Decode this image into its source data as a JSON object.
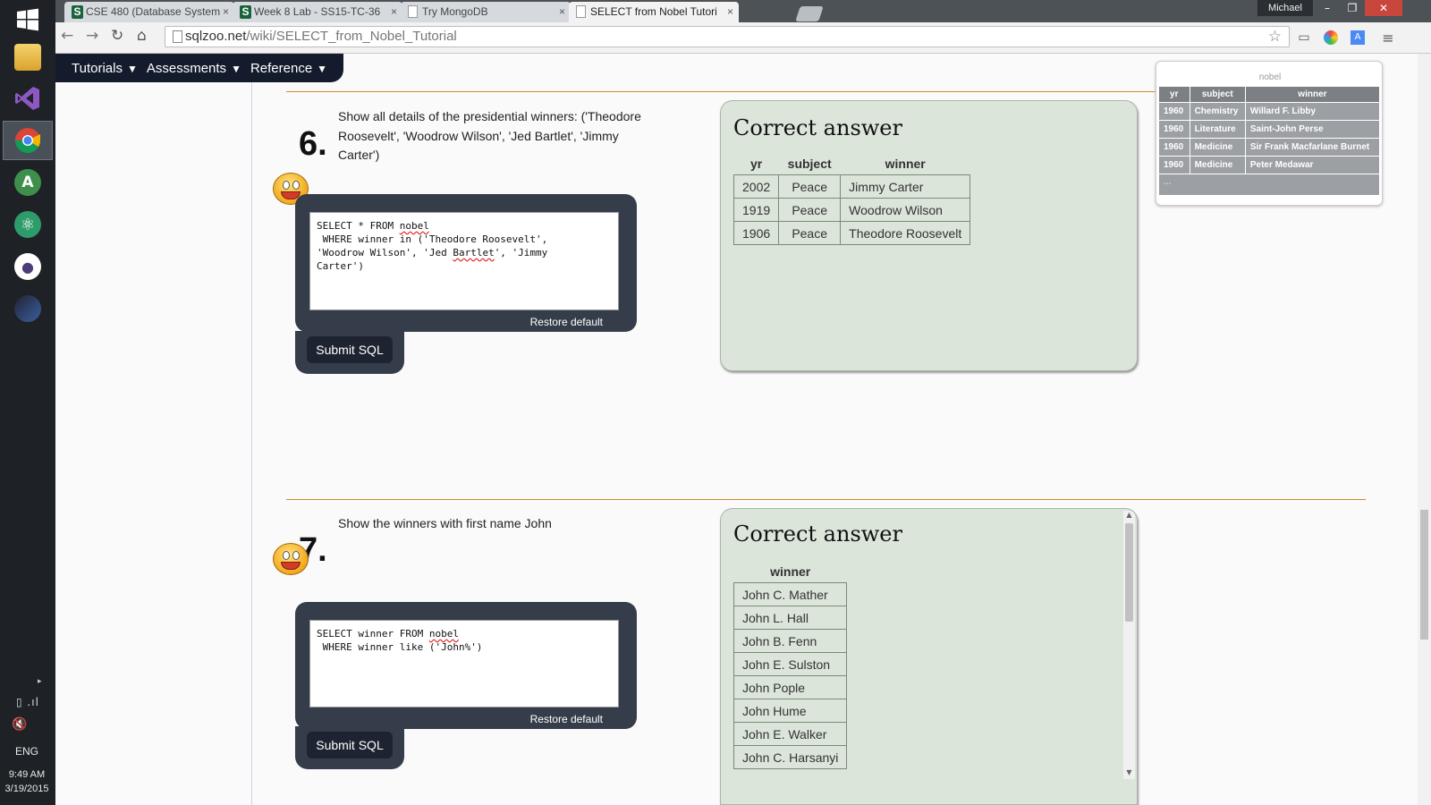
{
  "taskbar": {
    "icons": [
      "windows-start",
      "file-explorer",
      "visual-studio",
      "chrome",
      "android-studio",
      "atom",
      "github",
      "eclipse"
    ],
    "tray_arrow": "▸",
    "net": "▯ .ıl",
    "vol": "🔇",
    "language": "ENG",
    "time": "9:49 AM",
    "date": "3/19/2015"
  },
  "browser": {
    "tabs": [
      {
        "label": "CSE 480 (Database System",
        "favicon": "S",
        "active": false
      },
      {
        "label": "Week 8 Lab - SS15-TC-36",
        "favicon": "S",
        "active": false
      },
      {
        "label": "Try MongoDB",
        "favicon": "page",
        "active": false
      },
      {
        "label": "SELECT from Nobel Tutori",
        "favicon": "page",
        "active": true
      }
    ],
    "close_glyph": "×",
    "user": "Michael",
    "url_host": "sqlzoo.net",
    "url_path": "/wiki/SELECT_from_Nobel_Tutorial"
  },
  "nav": {
    "items": [
      "Tutorials",
      "Assessments",
      "Reference"
    ],
    "arrow": "▼"
  },
  "nobel_ref": {
    "caption": "nobel",
    "columns": [
      "yr",
      "subject",
      "winner"
    ],
    "rows": [
      [
        "1960",
        "Chemistry",
        "Willard F. Libby"
      ],
      [
        "1960",
        "Literature",
        "Saint-John Perse"
      ],
      [
        "1960",
        "Medicine",
        "Sir Frank Macfarlane Burnet"
      ],
      [
        "1960",
        "Medicine",
        "Peter Medawar"
      ]
    ],
    "more": "..."
  },
  "questions": [
    {
      "number": "6.",
      "text": "Show all details of the presidential winners: ('Theodore Roosevelt', 'Woodrow Wilson', 'Jed Bartlet', 'Jimmy Carter')",
      "sql_lines": [
        [
          "SELECT * FROM ",
          "nobel",
          ""
        ],
        [
          " WHERE winner in ('Theodore Roosevelt',",
          "",
          ""
        ],
        [
          "'Woodrow Wilson', 'Jed ",
          "Bartlet",
          "', 'Jimmy"
        ],
        [
          "Carter')",
          "",
          ""
        ]
      ],
      "restore": "Restore default",
      "submit": "Submit SQL",
      "answer_title": "Correct answer",
      "answer_columns": [
        "yr",
        "subject",
        "winner"
      ],
      "answer_rows": [
        [
          "2002",
          "Peace",
          "Jimmy Carter"
        ],
        [
          "1919",
          "Peace",
          "Woodrow Wilson"
        ],
        [
          "1906",
          "Peace",
          "Theodore Roosevelt"
        ]
      ]
    },
    {
      "number": "7.",
      "text": "Show the winners with first name John",
      "sql_lines": [
        [
          "SELECT winner FROM ",
          "nobel",
          ""
        ],
        [
          " WHERE winner like ('John%')",
          "",
          ""
        ]
      ],
      "restore": "Restore default",
      "submit": "Submit SQL",
      "answer_title": "Correct answer",
      "answer_columns": [
        "winner"
      ],
      "answer_rows": [
        [
          "John C. Mather"
        ],
        [
          "John L. Hall"
        ],
        [
          "John B. Fenn"
        ],
        [
          "John E. Sulston"
        ],
        [
          "John Pople"
        ],
        [
          "John Hume"
        ],
        [
          "John E. Walker"
        ],
        [
          "John C. Harsanyi"
        ]
      ]
    }
  ]
}
